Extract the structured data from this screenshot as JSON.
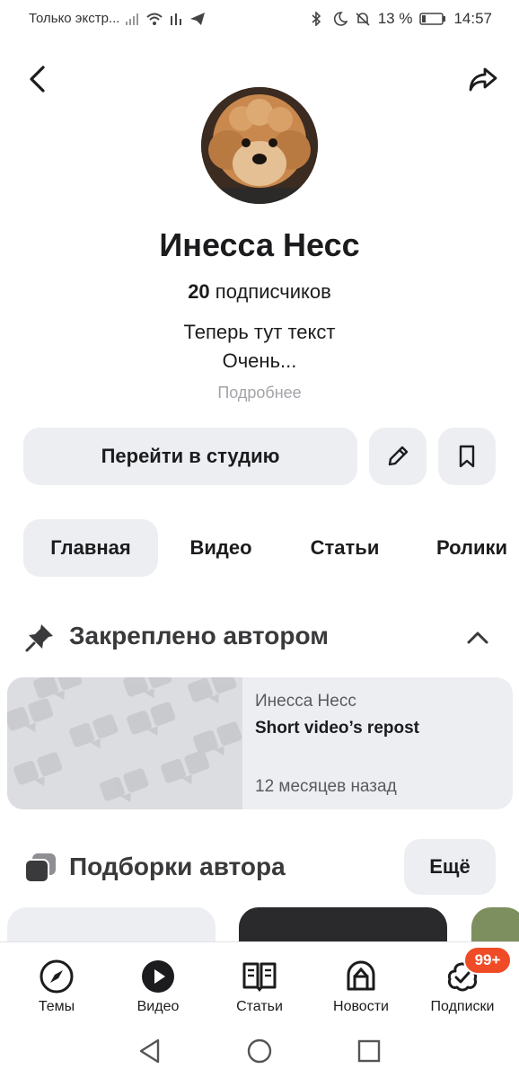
{
  "status_bar": {
    "left_text": "Только экстр...",
    "battery": "13 %",
    "time": "14:57",
    "icons": [
      "sim-icon",
      "wifi-icon",
      "signal-icon",
      "telegram-icon",
      "bluetooth-icon",
      "moon-icon",
      "bell-off-icon",
      "battery-icon"
    ]
  },
  "profile": {
    "name": "Инесса Несс",
    "subscribers_count": "20",
    "subscribers_label": "подписчиков",
    "description_line1": "Теперь тут текст",
    "description_line2": "Очень...",
    "more_link": "Подробнее"
  },
  "actions": {
    "studio_label": "Перейти в студию",
    "edit_icon": "pencil-icon",
    "bookmark_icon": "bookmark-icon"
  },
  "tabs": [
    {
      "label": "Главная",
      "active": true
    },
    {
      "label": "Видео",
      "active": false
    },
    {
      "label": "Статьи",
      "active": false
    },
    {
      "label": "Ролики",
      "active": false
    }
  ],
  "pinned": {
    "section_title": "Закреплено автором",
    "card": {
      "author": "Инесса Несс",
      "title": "Short video’s repost",
      "time": "12 месяцев назад"
    }
  },
  "collections": {
    "section_title": "Подборки автора",
    "more_label": "Ещё"
  },
  "bottom_nav": [
    {
      "label": "Темы",
      "icon": "compass-icon"
    },
    {
      "label": "Видео",
      "icon": "play-icon"
    },
    {
      "label": "Статьи",
      "icon": "book-icon"
    },
    {
      "label": "Новости",
      "icon": "news-icon"
    },
    {
      "label": "Подписки",
      "icon": "subscriptions-icon"
    }
  ],
  "badge": "99+",
  "colors": {
    "accent_badge": "#f04b27",
    "chip_bg": "#eceef2",
    "text": "#1c1c1e",
    "muted": "#a3a3a8"
  }
}
